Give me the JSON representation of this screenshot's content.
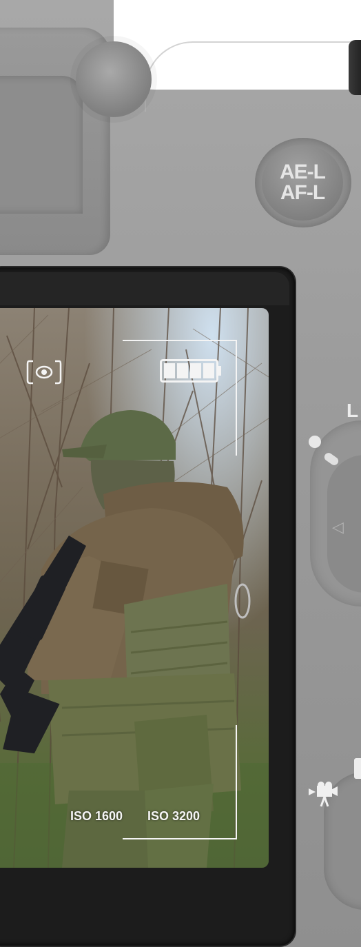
{
  "camera": {
    "ael_button": {
      "line1": "AE-L",
      "line2": "AF-L"
    },
    "side_dial_letter": "L",
    "movie_icon": "movie-camera-icon"
  },
  "lcd": {
    "metering_icon": "spot-metering-icon",
    "battery": {
      "icon": "battery-icon",
      "level": 1.0,
      "bars": 4
    },
    "iso_options": [
      {
        "label": "ISO 1600"
      },
      {
        "label": "ISO 3200"
      }
    ]
  }
}
